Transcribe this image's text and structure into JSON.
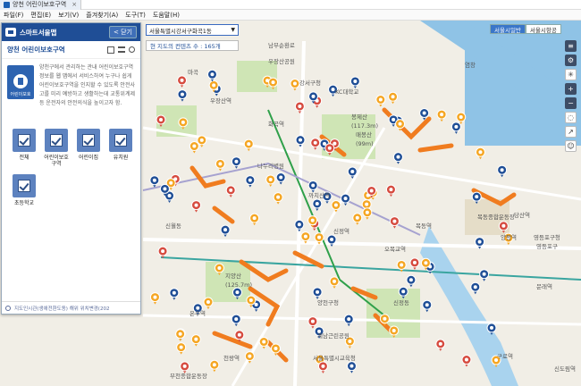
{
  "browser": {
    "tab_title": "양천 어린이보호구역",
    "tab_close": "×",
    "menu": [
      "파일(F)",
      "편집(E)",
      "보기(V)",
      "즐겨찾기(A)",
      "도구(T)",
      "도움말(H)"
    ]
  },
  "panel": {
    "app_name": "스마트서울맵",
    "collapse_label": "< 닫기",
    "title": "양천 어린이보호구역",
    "badge_label": "어린이보호",
    "description": "양천구에서 관리하는 관내 어린이보호구역 정보를 웹 맵에서 서비스하여 누구나 쉽게 어린이보호구역을 인지할 수 있도록 안전사고를 미리 예방하고 생활하는데 교통위계제 등 운전자의 안전의식을 높이고자 함.",
    "categories": [
      {
        "label": "전체"
      },
      {
        "label": "어린이보호구역"
      },
      {
        "label": "어린이집"
      },
      {
        "label": "유치원"
      },
      {
        "label": "초등학교"
      }
    ],
    "footer": "지도인시관(생애전환도동) 해위 위치변경(202"
  },
  "map": {
    "address_select": "서울특별시강서구화곡1동",
    "address_chevron": "▼",
    "count_text": "현 지도의 컨텐츠 수 : 165개",
    "map_types": [
      "서울시일반",
      "서울시항공"
    ],
    "tools": [
      "layers-icon",
      "settings-icon",
      "compass-icon",
      "zoom-in-icon",
      "zoom-out-icon",
      "measure-distance-icon",
      "measure-area-icon",
      "person-icon"
    ],
    "labels": [
      "우장산공원",
      "강서구청",
      "KC대학교",
      "봉제산",
      "(117.3m)",
      "매봉산",
      "(99m)",
      "화곡역",
      "우장산역",
      "까치산역",
      "신정역",
      "목동역",
      "오목교역",
      "양평역",
      "영등포구청",
      "영등포구",
      "지양산",
      "(125.7m)",
      "양천구청",
      "신월동",
      "신정동",
      "계남근린공원",
      "서울특별시교육청",
      "구로역",
      "신도림역",
      "남부순환로",
      "나누리병원",
      "염창",
      "마곡",
      "목동종합운동장",
      "당산역",
      "문래역",
      "부천종합운동장",
      "천왕역",
      "온수역"
    ]
  }
}
